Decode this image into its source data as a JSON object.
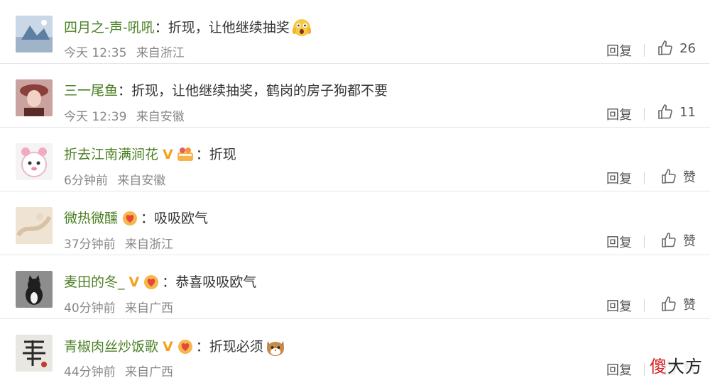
{
  "comments": [
    {
      "username": "四月之-声-吼吼",
      "colon": "：",
      "text": "折现，让他继续抽奖",
      "time": "今天 12:35",
      "location": "来自浙江",
      "reply_label": "回复",
      "like_count": "26"
    },
    {
      "username": "三一尾鱼",
      "colon": "：",
      "text": "折现，让他继续抽奖，鹤岗的房子狗都不要",
      "time": "今天 12:39",
      "location": "来自安徽",
      "reply_label": "回复",
      "like_count": "11"
    },
    {
      "username": "折去江南满涧花",
      "colon": "：",
      "text": "折现",
      "time": "6分钟前",
      "location": "来自安徽",
      "reply_label": "回复",
      "like_count": "赞"
    },
    {
      "username": "微热微醺",
      "colon": "：",
      "text": "吸吸欧气",
      "time": "37分钟前",
      "location": "来自浙江",
      "reply_label": "回复",
      "like_count": "赞"
    },
    {
      "username": "麦田的冬_",
      "colon": "：",
      "text": "恭喜吸吸欧气",
      "time": "40分钟前",
      "location": "来自广西",
      "reply_label": "回复",
      "like_count": "赞"
    },
    {
      "username": "青椒肉丝炒饭歌",
      "colon": "：",
      "text": "折现必须",
      "time": "44分钟前",
      "location": "来自广西",
      "reply_label": "回复",
      "like_count": "赞"
    }
  ],
  "vip_mark": "V",
  "icons": {
    "like": "thumbs-up-icon",
    "vip": "vip-v-icon",
    "badge": "fan-badge-icon",
    "emoji_scared": "scared-face-emoji",
    "emoji_cat": "cat-face-emoji"
  },
  "colors": {
    "username": "#4a7f23",
    "vip": "#f2a21d",
    "meta": "#888888",
    "divider": "#e6e6e6"
  },
  "watermark": {
    "first_char": "傻",
    "rest": "大方"
  }
}
